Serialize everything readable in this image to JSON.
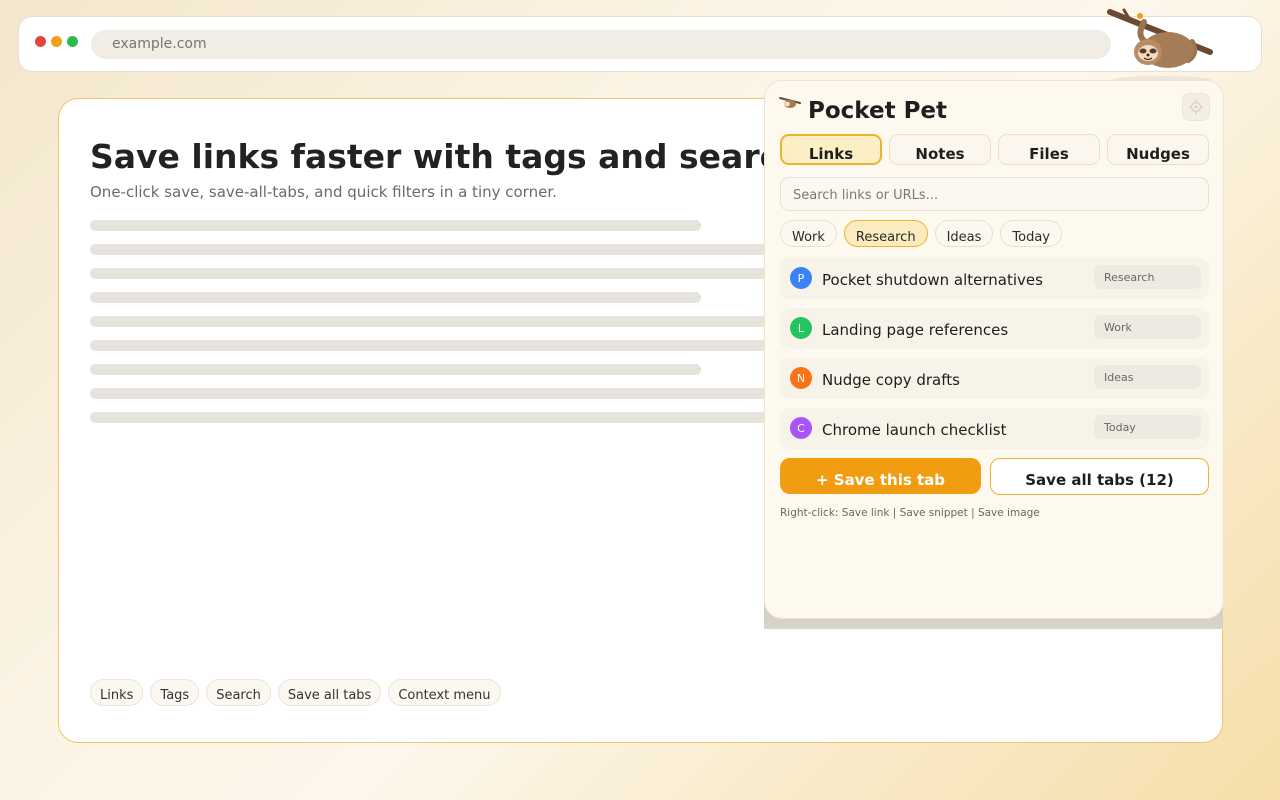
{
  "browser": {
    "url": "example.com"
  },
  "page": {
    "title": "Save links faster with tags and search",
    "subtitle": "One-click save, save-all-tabs, and quick filters in a tiny corner.",
    "feature_chips": [
      "Links",
      "Tags",
      "Search",
      "Save all tabs",
      "Context menu"
    ]
  },
  "popup": {
    "title": "Pocket Pet",
    "settings_icon": "gear-icon",
    "tabs": [
      {
        "label": "Links",
        "active": true
      },
      {
        "label": "Notes",
        "active": false
      },
      {
        "label": "Files",
        "active": false
      },
      {
        "label": "Nudges",
        "active": false
      }
    ],
    "search_placeholder": "Search links or URLs...",
    "filters": [
      {
        "label": "Work",
        "active": false
      },
      {
        "label": "Research",
        "active": true
      },
      {
        "label": "Ideas",
        "active": false
      },
      {
        "label": "Today",
        "active": false
      }
    ],
    "items": [
      {
        "initial": "P",
        "title": "Pocket shutdown alternatives",
        "tag": "Research",
        "color": "#3b82f6"
      },
      {
        "initial": "L",
        "title": "Landing page references",
        "tag": "Work",
        "color": "#22c55e"
      },
      {
        "initial": "N",
        "title": "Nudge copy drafts",
        "tag": "Ideas",
        "color": "#f97316"
      },
      {
        "initial": "C",
        "title": "Chrome launch checklist",
        "tag": "Today",
        "color": "#a855f7"
      }
    ],
    "save_tab_label": "+ Save this tab",
    "save_all_label": "Save all tabs (12)",
    "context_hint": "Right-click: Save link | Save snippet | Save image"
  },
  "colors": {
    "accent": "#f29c12",
    "accent_border": "#efb12f"
  }
}
